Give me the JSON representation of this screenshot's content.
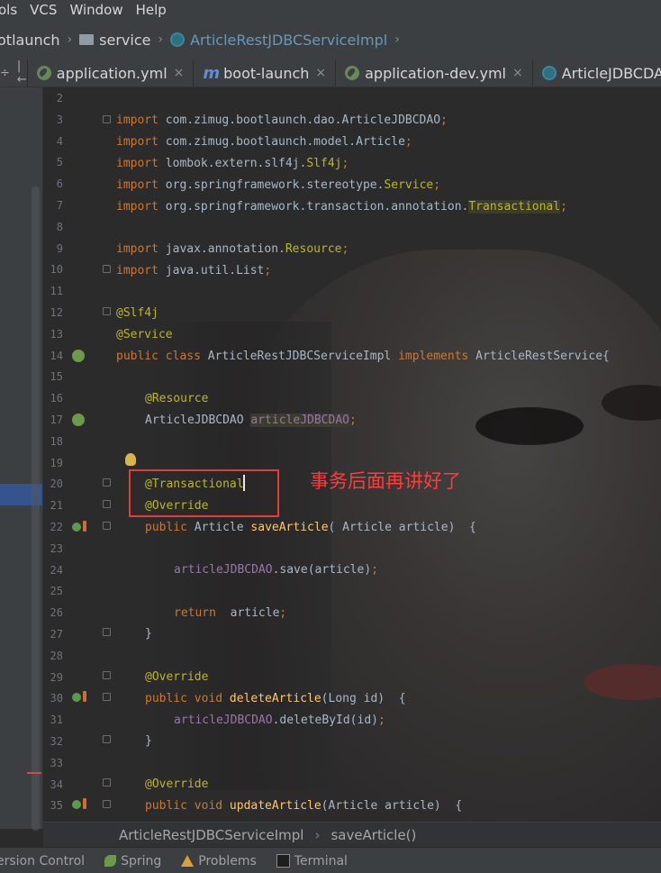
{
  "menu": [
    "ols",
    "VCS",
    "Window",
    "Help"
  ],
  "breadcrumb": {
    "project": "otlaunch",
    "folder": "service",
    "class": "ArticleRestJDBCServiceImpl"
  },
  "tabs": [
    {
      "label": "application.yml",
      "close": "×",
      "active": false
    },
    {
      "label": "boot-launch",
      "close": "×",
      "active": false
    },
    {
      "label": "application-dev.yml",
      "close": "×",
      "active": false
    },
    {
      "label": "ArticleJDBCDAO.j",
      "close": "",
      "active": false
    }
  ],
  "tab_tools": {
    "settings": "÷",
    "collapse": "|←"
  },
  "code_lines": [
    {
      "n": "2"
    },
    {
      "n": "3"
    },
    {
      "n": "4"
    },
    {
      "n": "5"
    },
    {
      "n": "6"
    },
    {
      "n": "7"
    },
    {
      "n": "8"
    },
    {
      "n": "9"
    },
    {
      "n": "10"
    },
    {
      "n": "11"
    },
    {
      "n": "12"
    },
    {
      "n": "13"
    },
    {
      "n": "14"
    },
    {
      "n": "15"
    },
    {
      "n": "16"
    },
    {
      "n": "17"
    },
    {
      "n": "18"
    },
    {
      "n": "19"
    },
    {
      "n": "20"
    },
    {
      "n": "21"
    },
    {
      "n": "22"
    },
    {
      "n": "23"
    },
    {
      "n": "24"
    },
    {
      "n": "25"
    },
    {
      "n": "26"
    },
    {
      "n": "27"
    },
    {
      "n": "28"
    },
    {
      "n": "29"
    },
    {
      "n": "30"
    },
    {
      "n": "31"
    },
    {
      "n": "32"
    },
    {
      "n": "33"
    },
    {
      "n": "34"
    },
    {
      "n": "35"
    }
  ],
  "code": {
    "l3a": "import ",
    "l3b": "com.zimug.bootlaunch.dao.ArticleJDBCDAO",
    "l3c": ";",
    "l4a": "import ",
    "l4b": "com.zimug.bootlaunch.model.Article",
    "l4c": ";",
    "l5a": "import ",
    "l5b": "lombok.extern.slf4j.",
    "l5c": "Slf4j",
    "l5d": ";",
    "l6a": "import ",
    "l6b": "org.springframework.stereotype.",
    "l6c": "Service",
    "l6d": ";",
    "l7a": "import ",
    "l7b": "org.springframework.transaction.annotation.",
    "l7c": "Transactional",
    "l7d": ";",
    "l9a": "import ",
    "l9b": "javax.annotation.",
    "l9c": "Resource",
    "l9d": ";",
    "l10a": "import ",
    "l10b": "java.util.List",
    "l10c": ";",
    "l12": "@Slf4j",
    "l13": "@Service",
    "l14a": "public class ",
    "l14b": "ArticleRestJDBCServiceImpl ",
    "l14c": "implements ",
    "l14d": "ArticleRestService{",
    "l16": "@Resource",
    "l17a": "ArticleJDBCDAO ",
    "l17b": "articleJDBCDAO",
    "l17c": ";",
    "l20": "@Transactional",
    "l21": "@Override",
    "l22a": "public ",
    "l22b": "Article ",
    "l22c": "saveArticle",
    "l22d": "( Article article)  {",
    "l24a": "articleJDBCDAO",
    "l24b": ".save(article)",
    "l24c": ";",
    "l26a": "return ",
    "l26b": " article",
    "l26c": ";",
    "l27": "}",
    "l29": "@Override",
    "l30a": "public void ",
    "l30b": "deleteArticle",
    "l30c": "(Long id)  {",
    "l31a": "articleJDBCDAO",
    "l31b": ".deleteById(id)",
    "l31c": ";",
    "l32": "}",
    "l34": "@Override",
    "l35a": "public void ",
    "l35b": "updateArticle",
    "l35c": "(Article article)  {"
  },
  "annotation_text": "事务后面再讲好了",
  "editor_breadcrumb": {
    "class": "ArticleRestJDBCServiceImpl",
    "method": "saveArticle()",
    "arrow": "›"
  },
  "bottom_tools": [
    {
      "label": "ersion Control",
      "icon": "version-control-icon"
    },
    {
      "label": "Spring",
      "icon": "spring-leaf-icon"
    },
    {
      "label": "Problems",
      "icon": "warning-icon"
    },
    {
      "label": "Terminal",
      "icon": "terminal-icon"
    }
  ]
}
